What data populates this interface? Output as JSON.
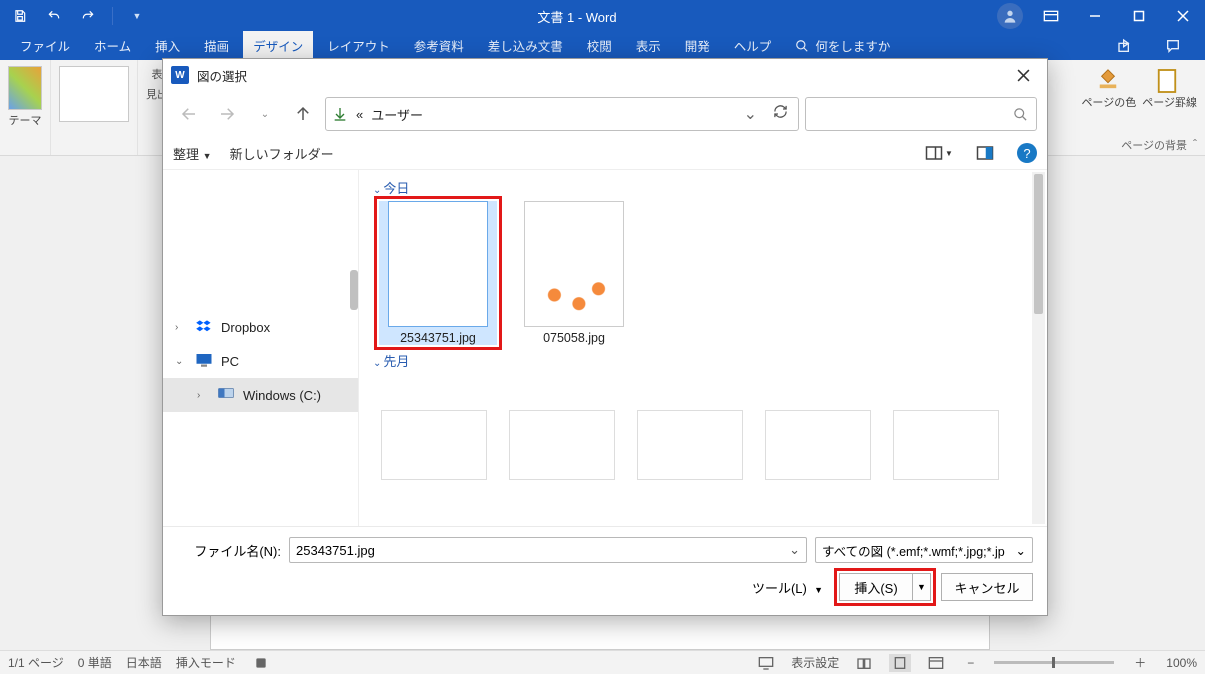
{
  "app": {
    "title": "文書 1  -  Word",
    "tabs": [
      "ファイル",
      "ホーム",
      "挿入",
      "描画",
      "デザイン",
      "レイアウト",
      "参考資料",
      "差し込み文書",
      "校閲",
      "表示",
      "開発",
      "ヘルプ"
    ],
    "active_tab_index": 4,
    "tell_me_placeholder": "何をしますか",
    "ribbon": {
      "themes_label": "テーマ",
      "group_side_items": [
        "表題",
        "見出し"
      ],
      "page_color_label": "ページの色",
      "page_border_label": "ページ罫線",
      "background_group_label": "ページの背景"
    }
  },
  "dialog": {
    "title": "図の選択",
    "breadcrumb_prefix": "«",
    "breadcrumb": "ユーザー",
    "organize": "整理",
    "new_folder": "新しいフォルダー",
    "tree": {
      "dropbox": "Dropbox",
      "pc": "PC",
      "drive": "Windows (C:)"
    },
    "sections": {
      "today": "今日",
      "last_month": "先月"
    },
    "files_today": [
      {
        "name": "25343751.jpg",
        "selected": true,
        "thumb": "bg-green-bubbles"
      },
      {
        "name": "075058.jpg",
        "selected": false,
        "thumb": "bg-fish"
      }
    ],
    "files_last_month": [
      {
        "thumb": "bg-apple1"
      },
      {
        "thumb": "bg-apple-tree"
      },
      {
        "thumb": "bg-apple-straw"
      },
      {
        "thumb": "bg-banana"
      },
      {
        "thumb": "bg-apple-cut"
      }
    ],
    "filename_label": "ファイル名(N):",
    "filename_value": "25343751.jpg",
    "filter_text": "すべての図 (*.emf;*.wmf;*.jpg;*.jp",
    "tools_label": "ツール(L)",
    "insert_label": "挿入(S)",
    "cancel_label": "キャンセル"
  },
  "status": {
    "page": "1/1 ページ",
    "words": "0 単語",
    "lang": "日本語",
    "mode": "挿入モード",
    "display_settings": "表示設定",
    "zoom": "100%"
  }
}
